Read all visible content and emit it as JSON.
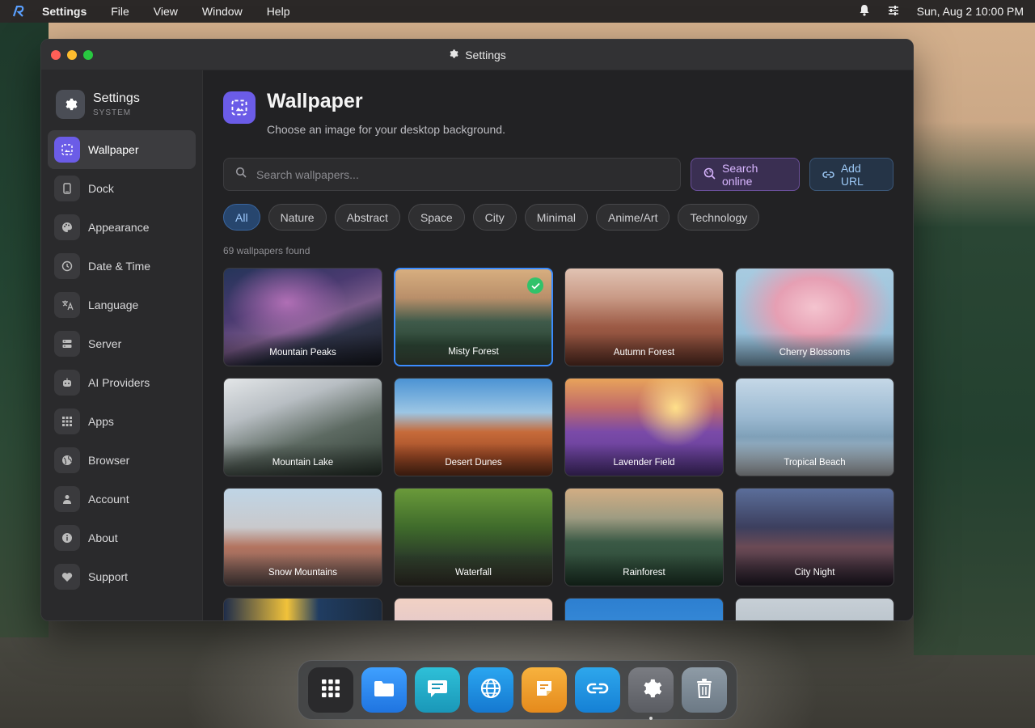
{
  "menubar": {
    "app_name": "Settings",
    "menus": [
      "File",
      "View",
      "Window",
      "Help"
    ],
    "clock": "Sun, Aug 2 10:00 PM"
  },
  "window": {
    "title": "Settings"
  },
  "sidebar": {
    "title": "Settings",
    "subtitle": "SYSTEM",
    "items": [
      {
        "label": "Wallpaper",
        "icon": "wallpaper-icon",
        "active": true
      },
      {
        "label": "Dock",
        "icon": "dock-icon"
      },
      {
        "label": "Appearance",
        "icon": "palette-icon"
      },
      {
        "label": "Date & Time",
        "icon": "clock-icon"
      },
      {
        "label": "Language",
        "icon": "translate-icon"
      },
      {
        "label": "Server",
        "icon": "server-icon"
      },
      {
        "label": "AI Providers",
        "icon": "robot-icon"
      },
      {
        "label": "Apps",
        "icon": "apps-grid-icon"
      },
      {
        "label": "Browser",
        "icon": "globe-icon"
      },
      {
        "label": "Account",
        "icon": "person-icon"
      },
      {
        "label": "About",
        "icon": "info-icon"
      },
      {
        "label": "Support",
        "icon": "heart-icon"
      }
    ]
  },
  "main": {
    "title": "Wallpaper",
    "subtitle": "Choose an image for your desktop background.",
    "search_placeholder": "Search wallpapers...",
    "search_online_label": "Search online",
    "add_url_label": "Add URL",
    "categories": [
      "All",
      "Nature",
      "Abstract",
      "Space",
      "City",
      "Minimal",
      "Anime/Art",
      "Technology"
    ],
    "active_category": "All",
    "count_text": "69 wallpapers found",
    "wallpapers": [
      {
        "label": "Mountain Peaks"
      },
      {
        "label": "Misty Forest",
        "selected": true
      },
      {
        "label": "Autumn Forest"
      },
      {
        "label": "Cherry Blossoms"
      },
      {
        "label": "Mountain Lake"
      },
      {
        "label": "Desert Dunes"
      },
      {
        "label": "Lavender Field"
      },
      {
        "label": "Tropical Beach"
      },
      {
        "label": "Snow Mountains"
      },
      {
        "label": "Waterfall"
      },
      {
        "label": "Rainforest"
      },
      {
        "label": "City Night"
      },
      {
        "label": ""
      },
      {
        "label": ""
      },
      {
        "label": ""
      },
      {
        "label": ""
      }
    ]
  },
  "dock": [
    {
      "icon": "launchpad-icon",
      "color": "#2a2a2c"
    },
    {
      "icon": "folder-icon",
      "color": "#2e8cf0"
    },
    {
      "icon": "chat-icon",
      "color": "#22a7c9"
    },
    {
      "icon": "browser-globe-icon",
      "color": "#1d8fe0"
    },
    {
      "icon": "notes-icon",
      "color": "#f0a22e"
    },
    {
      "icon": "link-icon",
      "color": "#2a9be6"
    },
    {
      "icon": "settings-gear-icon",
      "color": "#6b6d73",
      "running": true
    },
    {
      "icon": "trash-icon",
      "color": "#7c8994"
    }
  ]
}
